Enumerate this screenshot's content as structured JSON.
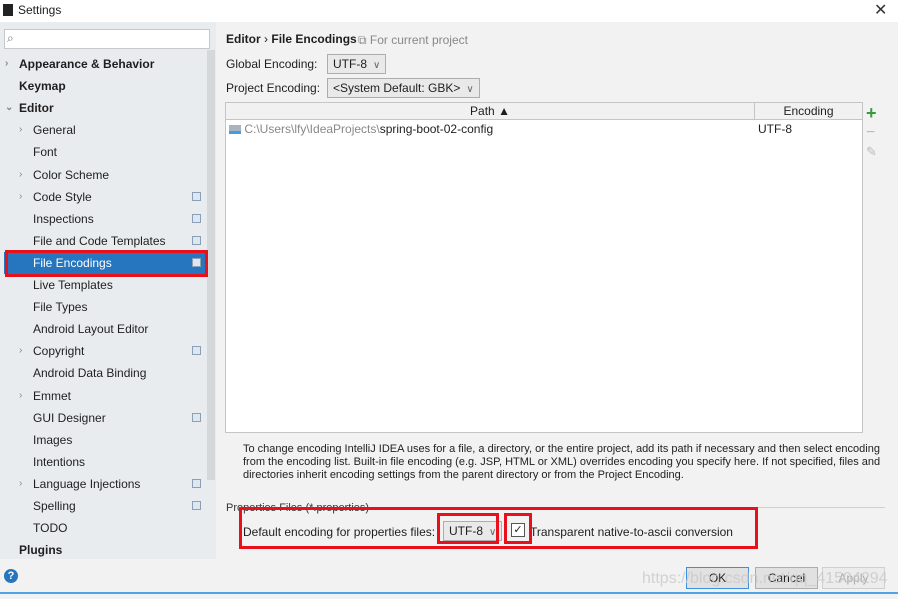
{
  "window": {
    "title": "Settings",
    "close_icon": "close-icon"
  },
  "search": {
    "placeholder": "",
    "icon": "search-icon"
  },
  "sidebar": {
    "items": [
      {
        "label": "Appearance & Behavior",
        "bold": true,
        "arrow": "›",
        "level": 0
      },
      {
        "label": "Keymap",
        "bold": true,
        "level": 0
      },
      {
        "label": "Editor",
        "bold": true,
        "arrow": "⌄",
        "level": 0
      },
      {
        "label": "General",
        "arrow": "›",
        "level": 1
      },
      {
        "label": "Font",
        "level": 1
      },
      {
        "label": "Color Scheme",
        "arrow": "›",
        "level": 1
      },
      {
        "label": "Code Style",
        "arrow": "›",
        "level": 1,
        "project": true
      },
      {
        "label": "Inspections",
        "level": 1,
        "project": true
      },
      {
        "label": "File and Code Templates",
        "level": 1,
        "project": true
      },
      {
        "label": "File Encodings",
        "level": 1,
        "project": true,
        "selected": true
      },
      {
        "label": "Live Templates",
        "level": 1
      },
      {
        "label": "File Types",
        "level": 1
      },
      {
        "label": "Android Layout Editor",
        "level": 1
      },
      {
        "label": "Copyright",
        "arrow": "›",
        "level": 1,
        "project": true
      },
      {
        "label": "Android Data Binding",
        "level": 1
      },
      {
        "label": "Emmet",
        "arrow": "›",
        "level": 1
      },
      {
        "label": "GUI Designer",
        "level": 1,
        "project": true
      },
      {
        "label": "Images",
        "level": 1
      },
      {
        "label": "Intentions",
        "level": 1
      },
      {
        "label": "Language Injections",
        "arrow": "›",
        "level": 1,
        "project": true
      },
      {
        "label": "Spelling",
        "level": 1,
        "project": true
      },
      {
        "label": "TODO",
        "level": 1
      },
      {
        "label": "Plugins",
        "bold": true,
        "level": 0
      }
    ]
  },
  "breadcrumb": {
    "parent": "Editor",
    "sep": "›",
    "current": "File Encodings",
    "scope": "For current project"
  },
  "global_encoding": {
    "label": "Global Encoding:",
    "value": "UTF-8"
  },
  "project_encoding": {
    "label": "Project Encoding:",
    "value": "<System Default: GBK>"
  },
  "table": {
    "columns": [
      "Path ▲",
      "Encoding"
    ],
    "rows": [
      {
        "path_prefix": "C:\\Users\\lfy\\IdeaProjects\\",
        "path_name": "spring-boot-02-config",
        "encoding": "UTF-8"
      }
    ]
  },
  "table_tools": {
    "add": "+",
    "remove": "−",
    "edit": "✎"
  },
  "description": "To change encoding IntelliJ IDEA uses for a file, a directory, or the entire project, add its path if necessary and then select encoding from the encoding list. Built-in file encoding (e.g. JSP, HTML or XML) overrides encoding you specify here. If not specified, files and directories inherit encoding settings from the parent directory or from the Project Encoding.",
  "properties": {
    "section": "Properties Files (*.properties)",
    "label": "Default encoding for properties files:",
    "value": "UTF-8",
    "checkbox_label": "Transparent native-to-ascii conversion",
    "checked": true
  },
  "buttons": {
    "ok": "OK",
    "cancel": "Cancel",
    "apply": "Apply",
    "help": "?"
  },
  "watermark": "https://blog.csdn.net/qq_41504294",
  "colors": {
    "selection": "#2675bf",
    "highlight": "#e8101b"
  }
}
